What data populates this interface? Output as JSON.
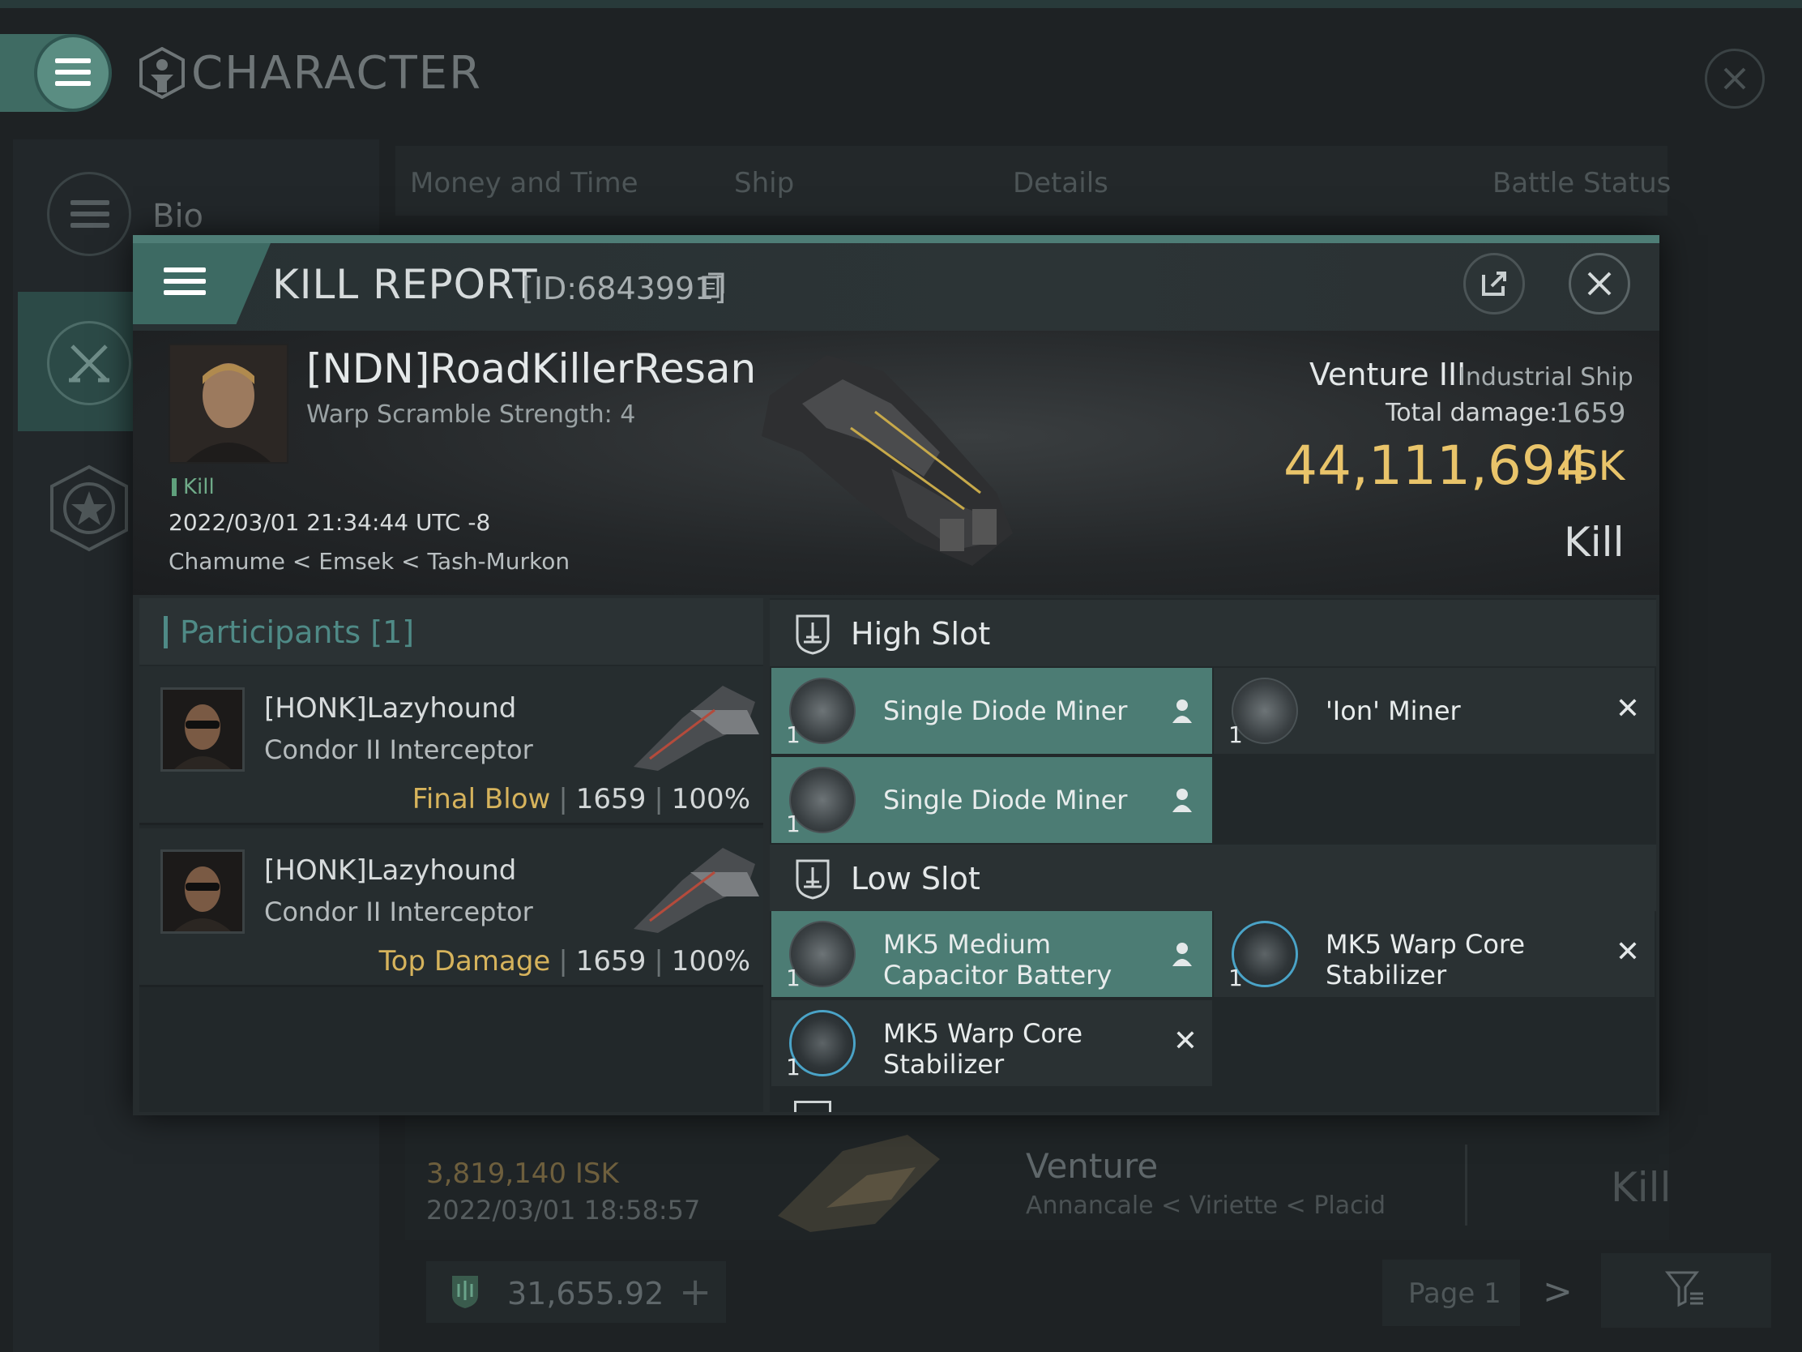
{
  "background": {
    "title": "CHARACTER",
    "nav": {
      "bio_label": "Bio"
    },
    "tabs": [
      "Money and Time",
      "Ship",
      "Details",
      "Battle Status"
    ],
    "row": {
      "isk": "3,819,140  ISK",
      "date": "2022/03/01  18:58:57",
      "ship": "Venture",
      "location": "Annancale < Viriette < Placid",
      "result": "Kill"
    },
    "wallet": "31,655.92",
    "page": "Page 1"
  },
  "modal": {
    "title": "KILL REPORT",
    "id": "[ID:6843991]",
    "victim": {
      "name": "[NDN]RoadKillerResan",
      "warp_scramble": "Warp Scramble Strength: 4",
      "tag": "Kill",
      "datetime": "2022/03/01 21:34:44 UTC -8",
      "location": "Chamume < Emsek < Tash-Murkon"
    },
    "ship": {
      "name": "Venture III",
      "class": "Industrial Ship",
      "damage_label": "Total damage:",
      "damage_value": "1659",
      "isk_value": "44,111,694",
      "isk_unit": "ISK",
      "result": "Kill"
    },
    "participants": {
      "title": "Participants [1]",
      "rows": [
        {
          "name": "[HONK]Lazyhound",
          "ship": "Condor II Interceptor",
          "tag": "Final Blow",
          "damage": "1659",
          "percent": "100%"
        },
        {
          "name": "[HONK]Lazyhound",
          "ship": "Condor II Interceptor",
          "tag": "Top Damage",
          "damage": "1659",
          "percent": "100%"
        }
      ]
    },
    "fitting": {
      "high_slot": {
        "title": "High Slot",
        "modules": [
          {
            "qty": "1",
            "name": "Single Diode Miner",
            "state": "fitted"
          },
          {
            "qty": "1",
            "name": "'Ion' Miner",
            "state": "destroyed"
          },
          {
            "qty": "1",
            "name": "Single Diode Miner",
            "state": "fitted"
          }
        ]
      },
      "low_slot": {
        "title": "Low Slot",
        "modules": [
          {
            "qty": "1",
            "name": "MK5 Medium Capacitor Battery",
            "state": "fitted"
          },
          {
            "qty": "1",
            "name": "MK5 Warp Core Stabilizer",
            "state": "destroyed"
          },
          {
            "qty": "1",
            "name": "MK5 Warp Core Stabilizer",
            "state": "destroyed"
          }
        ]
      }
    }
  }
}
